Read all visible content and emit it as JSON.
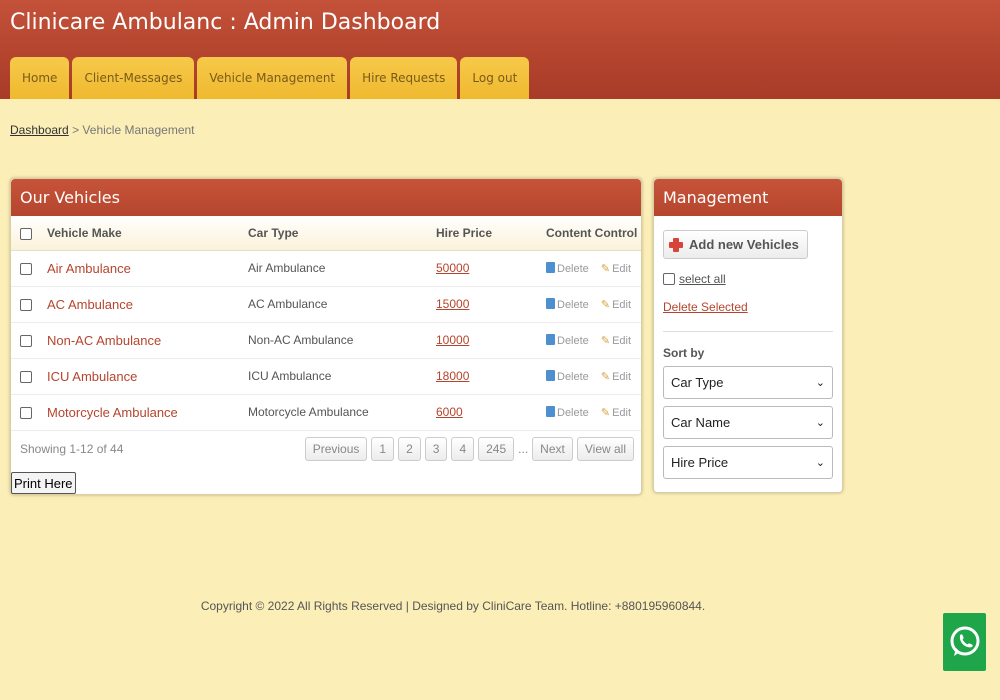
{
  "app": {
    "title": "Clinicare Ambulanc : Admin Dashboard"
  },
  "nav": {
    "tabs": [
      {
        "label": "Home"
      },
      {
        "label": "Client-Messages"
      },
      {
        "label": "Vehicle Management"
      },
      {
        "label": "Hire Requests"
      },
      {
        "label": "Log out"
      }
    ]
  },
  "breadcrumb": {
    "root": "Dashboard",
    "separator": ">",
    "current": "Vehicle Management"
  },
  "vehicles": {
    "title": "Our Vehicles",
    "columns": [
      "Vehicle Make",
      "Car Type",
      "Hire Price",
      "Content Control"
    ],
    "rows": [
      {
        "make": "Air Ambulance",
        "type": "Air Ambulance",
        "price": "50000"
      },
      {
        "make": "AC Ambulance",
        "type": "AC Ambulance",
        "price": "15000"
      },
      {
        "make": "Non-AC Ambulance",
        "type": "Non-AC Ambulance",
        "price": "10000"
      },
      {
        "make": "ICU Ambulance",
        "type": "ICU Ambulance",
        "price": "18000"
      },
      {
        "make": "Motorcycle Ambulance",
        "type": "Motorcycle Ambulance",
        "price": "6000"
      }
    ],
    "delete_label": "Delete",
    "edit_label": "Edit",
    "showing": "Showing 1-12 of 44",
    "pager": {
      "previous": "Previous",
      "pages": [
        "1",
        "2",
        "3",
        "4",
        "245"
      ],
      "ellipsis": "...",
      "next": "Next",
      "view_all": "View all"
    },
    "print_label": "Print Here"
  },
  "management": {
    "title": "Management",
    "add_label": "Add new Vehicles",
    "select_all": "select all",
    "delete_selected": "Delete Selected",
    "sort_label": "Sort by",
    "sort_options": [
      "Car Type",
      "Car Name",
      "Hire Price"
    ]
  },
  "footer": {
    "text": "Copyright © 2022 All Rights Reserved | Designed by CliniCare Team. Hotline: +880195960844."
  },
  "colors": {
    "header": "#b5452e",
    "tab": "#efb92f",
    "background": "#fbeeb7",
    "link": "#b5452e",
    "whatsapp": "#1fa64a"
  }
}
